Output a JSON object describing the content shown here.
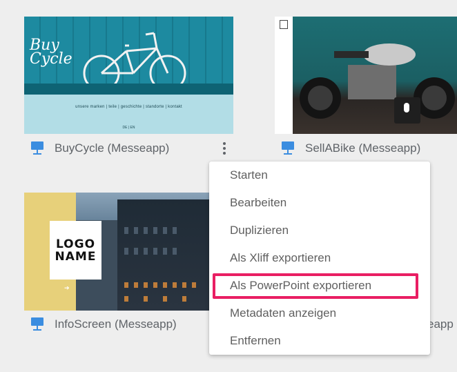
{
  "cards": [
    {
      "title": "BuyCycle (Messeapp)",
      "thumbnail": {
        "logo_line1": "Buy",
        "logo_line2": "Cycle",
        "nav": "unsere marken  |  teile  |  geschichte  |  standorte  |  kontakt",
        "lang": "DE | EN"
      }
    },
    {
      "title": "SellABike (Messeapp)"
    },
    {
      "title": "InfoScreen (Messeapp)",
      "thumbnail": {
        "logo_line1": "LOGO",
        "logo_line2": "NAME"
      }
    },
    {
      "title_fragment": "eapp"
    }
  ],
  "context_menu": {
    "items": [
      {
        "label": "Starten"
      },
      {
        "label": "Bearbeiten"
      },
      {
        "label": "Duplizieren"
      },
      {
        "label": "Als Xliff exportieren"
      },
      {
        "label": "Als PowerPoint exportieren",
        "highlighted": true
      },
      {
        "label": "Metadaten anzeigen"
      },
      {
        "label": "Entfernen"
      }
    ]
  },
  "colors": {
    "background": "#eeeeee",
    "icon_blue": "#3b8de0",
    "highlight": "#e91e63"
  },
  "icons": {
    "presentation": "presentation-icon",
    "more": "more-vert-icon"
  }
}
